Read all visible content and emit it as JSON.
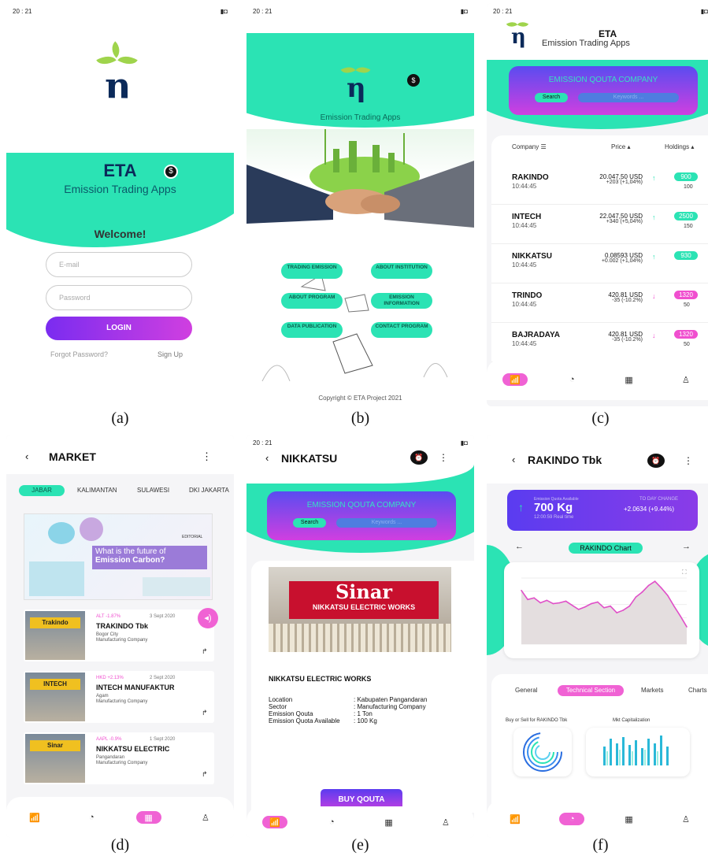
{
  "status_time": "20 : 21",
  "panel_a": {
    "brand": "ETA",
    "tagline": "Emission Trading Apps",
    "welcome": "Welcome!",
    "email_placeholder": "E-mail",
    "password_placeholder": "Password",
    "login": "LOGIN",
    "forgot": "Forgot Password?",
    "signup": "Sign Up",
    "caption": "(a)"
  },
  "panel_b": {
    "tagline": "Emission Trading Apps",
    "menu": [
      "TRADING EMISSION",
      "ABOUT INSTITUTION",
      "ABOUT PROGRAM",
      "EMISSION INFORMATION",
      "DATA PUBLICATION",
      "CONTACT PROGRAM"
    ],
    "copyright": "Copyright © ETA Project 2021",
    "caption": "(b)"
  },
  "panel_c": {
    "brand": "ETA",
    "tagline": "Emission Trading Apps",
    "card_title": "EMISSION QOUTA COMPANY",
    "search": "Search",
    "keywords": "Keywords ...",
    "col_company": "Company",
    "col_price": "Price",
    "col_holdings": "Holdings",
    "rows": [
      {
        "name": "RAKINDO",
        "time": "10:44:45",
        "price": "20.047,50 USD",
        "change": "+203 (+1,04%)",
        "hold": "900",
        "sub": "100",
        "dir": "up"
      },
      {
        "name": "INTECH",
        "time": "10:44:45",
        "price": "22.047,50 USD",
        "change": "+340 (+5,04%)",
        "hold": "2500",
        "sub": "150",
        "dir": "up"
      },
      {
        "name": "NIKKATSU",
        "time": "10:44:45",
        "price": "0.08593 USD",
        "change": "+0.002 (+1,04%)",
        "hold": "930",
        "sub": "",
        "dir": "up"
      },
      {
        "name": "TRINDO",
        "time": "10:44:45",
        "price": "420.81 USD",
        "change": "-35 (-10.2%)",
        "hold": "1320",
        "sub": "50",
        "dir": "down"
      },
      {
        "name": "BAJRADAYA",
        "time": "10:44:45",
        "price": "420.81 USD",
        "change": "-35 (-10.2%)",
        "hold": "1320",
        "sub": "50",
        "dir": "down"
      }
    ],
    "caption": "(c)"
  },
  "panel_d": {
    "title": "MARKET",
    "tabs": [
      "JABAR",
      "KALIMANTAN",
      "SULAWESI",
      "DKI JAKARTA"
    ],
    "hero_line1": "What is the future of",
    "hero_line2": "Emission Carbon?",
    "hero_badge": "EDITORIAL",
    "items": [
      {
        "tag": "ALT -1.87%",
        "date": "3 Sept 2020",
        "name": "TRAKINDO Tbk",
        "city": "Bogor City",
        "type": "Manufacturing Company",
        "img": "Trakindo"
      },
      {
        "tag": "HKD +2.13%",
        "date": "2 Sept 2020",
        "name": "INTECH MANUFAKTUR",
        "city": "Agam",
        "type": "Manufacturing Company",
        "img": "INTECH"
      },
      {
        "tag": "AAPL -0.9%",
        "date": "1 Sept 2020",
        "name": "NIKKATSU ELECTRIC",
        "city": "Pangandaran",
        "type": "Manufacturing Company",
        "img": "Sinar"
      }
    ],
    "caption": "(d)"
  },
  "panel_e": {
    "title": "NIKKATSU",
    "card_title": "EMISSION QOUTA COMPANY",
    "search": "Search",
    "keywords": "Keywords ...",
    "sign_big": "Sinar",
    "sign_small": "NIKKATSU ELECTRIC WORKS",
    "company": "NIKKATSU ELECTRIC WORKS",
    "details": [
      {
        "k": "Location",
        "v": ": Kabupaten Pangandaran"
      },
      {
        "k": "Sector",
        "v": ": Manufacturing Company"
      },
      {
        "k": "Emission Qouta",
        "v": ": 1 Ton"
      },
      {
        "k": "Emission Quota Available",
        "v": ": 100 Kg"
      }
    ],
    "buy": "BUY QOUTA",
    "caption": "(e)"
  },
  "panel_f": {
    "title": "RAKINDO Tbk",
    "avail_label": "Emission Quota Available",
    "avail_value": "700 Kg",
    "avail_sub": "12:00:59 Real time",
    "today_label": "TO DAY CHANGE",
    "today_value": "+2.0634 (+9.44%)",
    "chart_pill": "RAKINDO Chart",
    "tabs": [
      "General",
      "Technical Section",
      "Markets",
      "Charts"
    ],
    "sec1": "Buy or Sell for RAKINDO Tbk",
    "sec2": "Mkt Capitalization",
    "caption": "(f)"
  },
  "colors": {
    "mint": "#2be3b4",
    "purple": "#7a2cf0",
    "pink": "#f04fcf"
  },
  "chart_data": {
    "type": "area",
    "series": [
      {
        "values": [
          6.5,
          5.4,
          5.6,
          5.0,
          5.3,
          4.9,
          5.0,
          5.2,
          4.7,
          4.2,
          4.5,
          4.9,
          5.1,
          4.4,
          4.6,
          3.8,
          4.1,
          4.6,
          5.7,
          6.3,
          7.1,
          7.6,
          6.8,
          5.9,
          4.6,
          3.4,
          2.1
        ]
      }
    ]
  }
}
